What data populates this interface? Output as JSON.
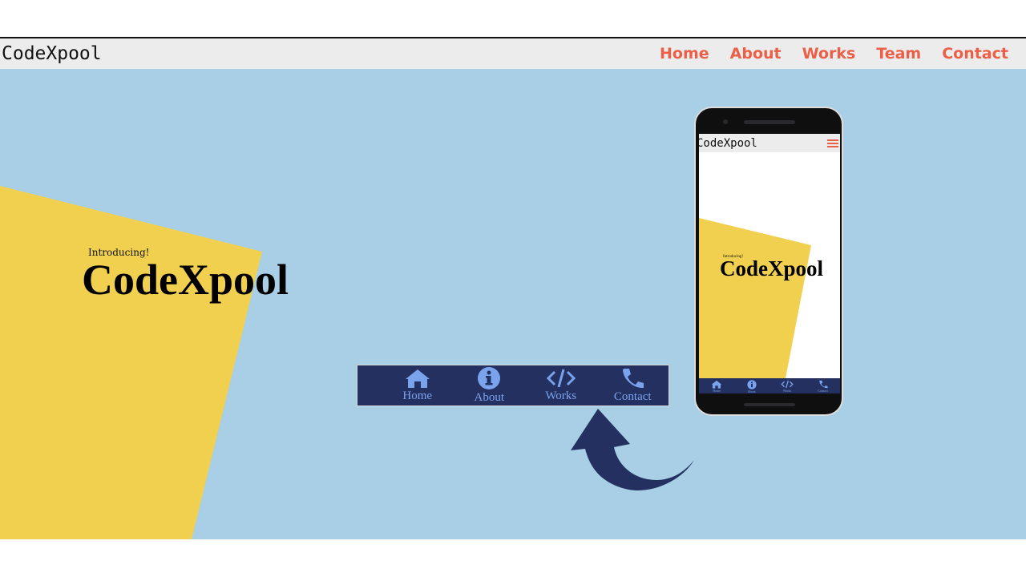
{
  "site": {
    "brand": "CodeXpool"
  },
  "nav": {
    "links": [
      "Home",
      "About",
      "Works",
      "Team",
      "Contact"
    ]
  },
  "hero": {
    "intro_small": "Introducing!",
    "intro_big": "CodeXpool"
  },
  "bottom_nav": {
    "items": [
      {
        "label": "Home",
        "icon": "home-icon"
      },
      {
        "label": "About",
        "icon": "info-icon"
      },
      {
        "label": "Works",
        "icon": "code-icon"
      },
      {
        "label": "Contact",
        "icon": "phone-icon"
      }
    ]
  },
  "phone_screen": {
    "brand": "CodeXpool",
    "intro_small": "Introducing!",
    "intro_big": "CodeXpool",
    "nav_items": [
      "Home",
      "About",
      "Works",
      "Contact"
    ]
  },
  "colors": {
    "hero_bg": "#a8cfe6",
    "accent_yellow": "#f0d04e",
    "nav_text": "#ec5f46",
    "bottom_nav_bg": "#243060",
    "bottom_nav_icon": "#7aa3ee"
  }
}
